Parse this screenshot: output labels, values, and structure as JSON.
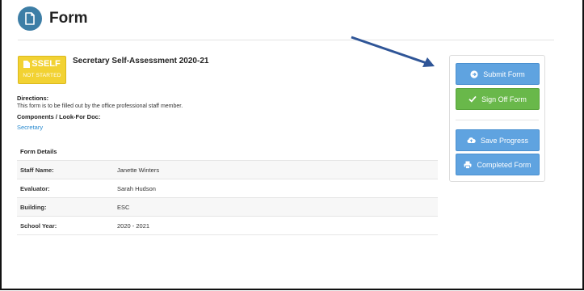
{
  "header": {
    "title": "Form",
    "icon": "document-icon",
    "icon_color": "#3d7ea6"
  },
  "badge": {
    "code": "SSELF",
    "status": "NOT STARTED",
    "color": "#f2d233"
  },
  "form": {
    "title": "Secretary Self-Assessment 2020-21",
    "directions_label": "Directions:",
    "directions_text": "This form is to be filled out by the office professional staff member.",
    "components_label": "Components / Look-For Doc:",
    "components_link": "Secretary"
  },
  "details": {
    "title": "Form Details",
    "rows": [
      {
        "label": "Staff Name:",
        "value": "Janette Winters"
      },
      {
        "label": "Evaluator:",
        "value": "Sarah Hudson"
      },
      {
        "label": "Building:",
        "value": "ESC"
      },
      {
        "label": "School Year:",
        "value": "2020 - 2021"
      }
    ]
  },
  "actions": {
    "submit": "Submit Form",
    "sign_off": "Sign Off Form",
    "save": "Save Progress",
    "completed": "Completed Form"
  },
  "colors": {
    "primary_button": "#5fa3e0",
    "success_button": "#69b84a",
    "annotation_arrow": "#2f5597"
  }
}
